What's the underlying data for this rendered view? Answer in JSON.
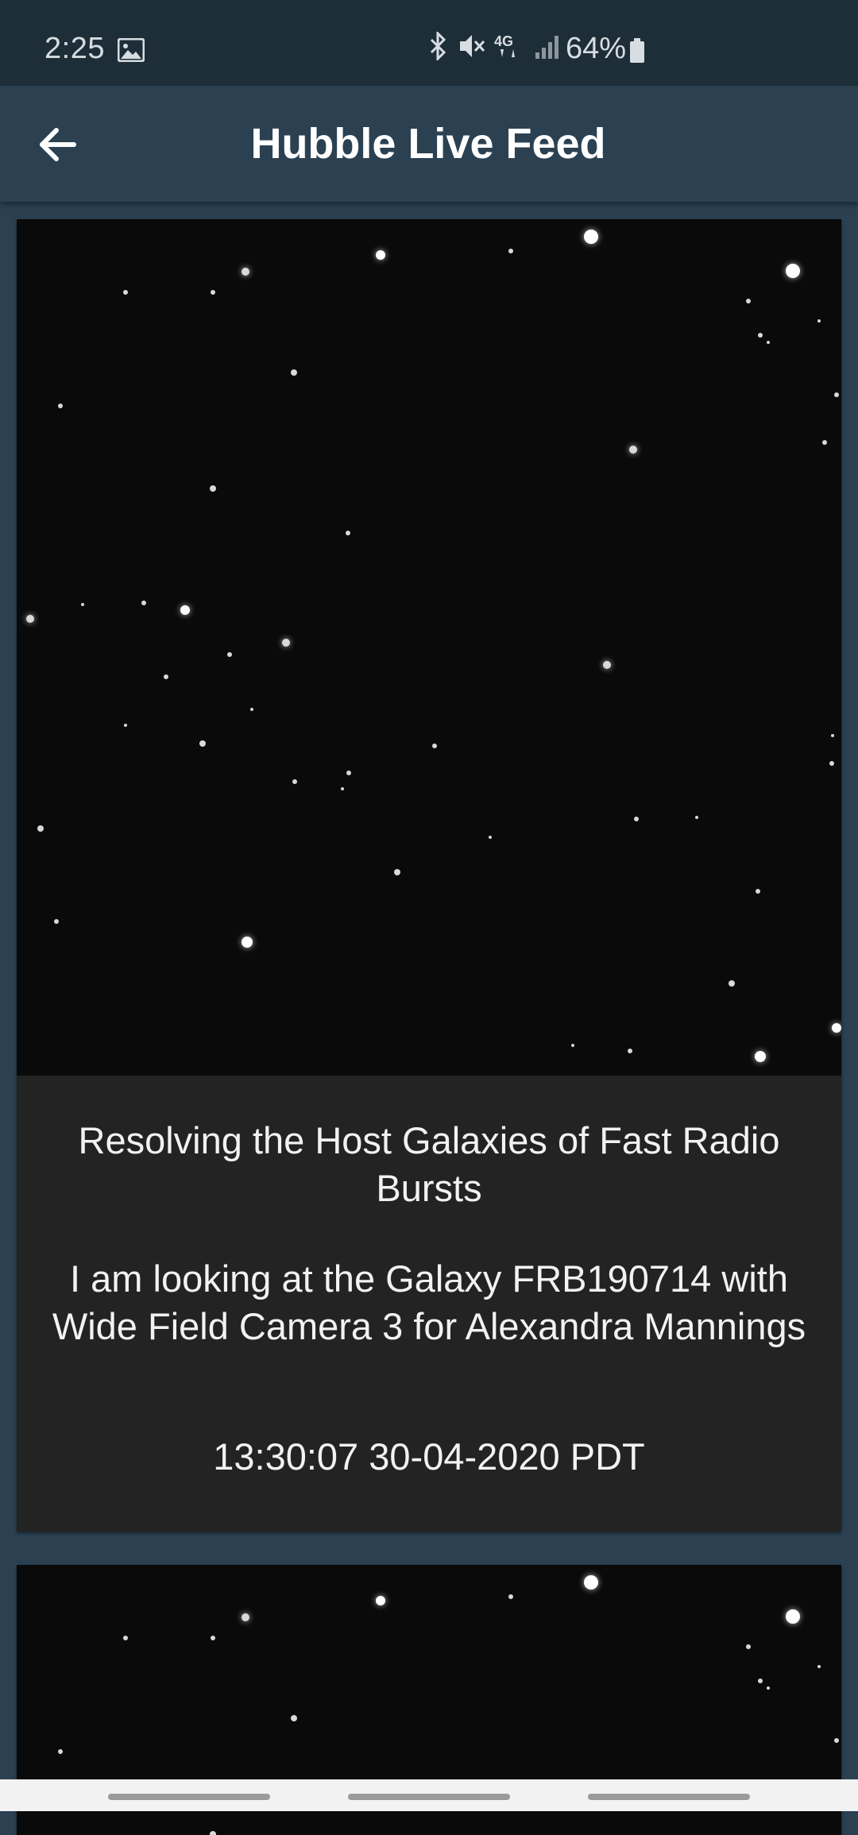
{
  "status_bar": {
    "time": "2:25",
    "battery": "64%",
    "icons": [
      "image-icon",
      "bluetooth-icon",
      "mute-icon",
      "4g-icon",
      "signal-icon",
      "battery-icon"
    ]
  },
  "app_bar": {
    "title": "Hubble Live Feed",
    "back_icon": "arrow-left-icon"
  },
  "feed": [
    {
      "title": "Resolving the Host Galaxies of Fast Radio Bursts",
      "description": "I am looking at the Galaxy FRB190714 with Wide Field Camera 3 for  Alexandra Mannings",
      "timestamp": "13:30:07 30-04-2020 PDT"
    }
  ],
  "colors": {
    "status_bar_bg": "#1e2e38",
    "app_bar_bg": "#2b4152",
    "card_bg": "#232323",
    "image_bg": "#0a0a0a"
  }
}
